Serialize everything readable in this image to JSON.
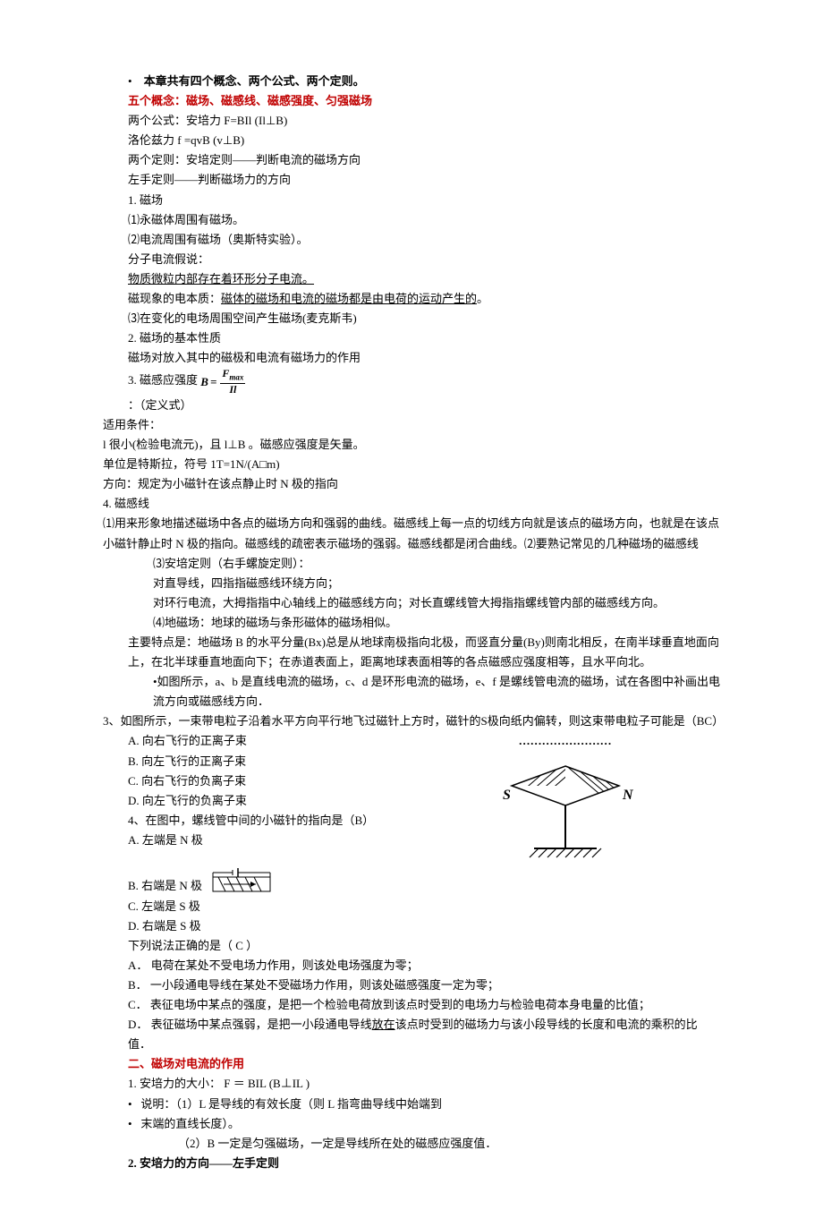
{
  "header": {
    "bullet": "•",
    "title_bold": "本章共有四个概念、两个公式、两个定则。",
    "subtitle": "五个概念：磁场、磁感线、磁感强度、匀强磁场"
  },
  "lines": {
    "l1": "两个公式：安培力 F=BIl      (Il⊥B)",
    "l2": "洛伦兹力 f =qvB     (v⊥B)",
    "l3": "两个定则：安培定则——判断电流的磁场方向",
    "l4": "左手定则——判断磁场力的方向",
    "l5": "1. 磁场",
    "l6": "⑴永磁体周围有磁场。",
    "l7": "⑵电流周围有磁场（奥斯特实验）。",
    "l8": "分子电流假说：",
    "l9_u": "物质微粒内部存在着环形分子电流。",
    "l10a": "磁现象的电本质：",
    "l10b_u": "磁体的磁场和电流的磁场都是由电荷的运动产生的",
    "l10c": "。",
    "l11": "⑶在变化的电场周围空间产生磁场(麦克斯韦)",
    "l12": "2. 磁场的基本性质",
    "l13": "磁场对放入其中的磁极和电流有磁场力的作用",
    "l14": "3. 磁感应强度",
    "formula_B": "B",
    "formula_eq": "=",
    "formula_num": "F",
    "formula_sub": "max",
    "formula_den": "Il",
    "l15": "：（定义式）",
    "l16": "适用条件：",
    "l17": "l  很小(检验电流元)，且 l⊥B 。磁感应强度是矢量。",
    "l18": "单位是特斯拉，符号  1T=1N/(A□m)",
    "l19": "方向：规定为小磁针在该点静止时 N 极的指向",
    "l20": "4.  磁感线",
    "l21": "⑴用来形象地描述磁场中各点的磁场方向和强弱的曲线。磁感线上每一点的切线方向就是该点的磁场方向，也就是在该点小磁针静止时 N 极的指向。磁感线的疏密表示磁场的强弱。磁感线都是闭合曲线。⑵要熟记常见的几种磁场的磁感线",
    "l22": "⑶安培定则（右手螺旋定则）：",
    "l23": "对直导线，四指指磁感线环绕方向；",
    "l24": "对环行电流，大拇指指中心轴线上的磁感线方向；对长直螺线管大拇指指螺线管内部的磁感线方向。",
    "l25": "⑷地磁场：地球的磁场与条形磁体的磁场相似。",
    "l26": "主要特点是：地磁场 B 的水平分量(Bx)总是从地球南极指向北极，而竖直分量(By)则南北相反，在南半球垂直地面向上，在北半球垂直地面向下；在赤道表面上，距离地球表面相等的各点磁感应强度相等，且水平向北。",
    "l27": "•如图所示，a、b 是直线电流的磁场，c、d 是环形电流的磁场，e、f 是螺线管电流的磁场，试在各图中补画出电流方向或磁感线方向．",
    "q3_stem": "3、如图所示，一束带电粒子沿着水平方向平行地飞过磁针上方时，磁针的S极向纸内偏转，则这束带电粒子可能是（BC）",
    "q3_fig_caption": "……………………",
    "q3_A": "A. 向右飞行的正离子束",
    "q3_B": "B. 向左飞行的正离子束",
    "q3_C": "C. 向右飞行的负离子束",
    "q3_D": "D. 向左飞行的负离子束",
    "q3_S": "S",
    "q3_N": "N",
    "q4_stem": "4、在图中，螺线管中间的小磁针的指向是（B）",
    "q4_A": "A. 左端是 N 极",
    "q4_B": "B. 右端是 N 极",
    "q4_C": "C. 左端是 S 极",
    "q4_D": "D. 右端是 S 极",
    "q5_stem": "下列说法正确的是（ C   ）",
    "q5_A": "A．  电荷在某处不受电场力作用，则该处电场强度为零；",
    "q5_B": "B．  一小段通电导线在某处不受磁场力作用，则该处磁感强度一定为零；",
    "q5_C": "C．  表征电场中某点的强度，是把一个检验电荷放到该点时受到的电场力与检验电荷本身电量的比值；",
    "q5_D_a": "D．  表征磁场中某点强弱，是把一小段通电导线",
    "q5_D_u": "放在",
    "q5_D_b": "该点时受到的磁场力与该小段导线的长度和电流的乘积的比值．",
    "sec2_title": "二、磁场对电流的作用",
    "sec2_l1": "1. 安培力的大小：   F ＝ BIL         (B⊥IL )",
    "sec2_l2": "说明：（1）L 是导线的有效长度（则 L 指弯曲导线中始端到",
    "sec2_l3": "末端的直线长度）。",
    "sec2_l4": "（2）B 一定是匀强磁场，一定是导线所在处的磁感应强度值．",
    "sec2_h": "2. 安培力的方向——左手定则"
  }
}
